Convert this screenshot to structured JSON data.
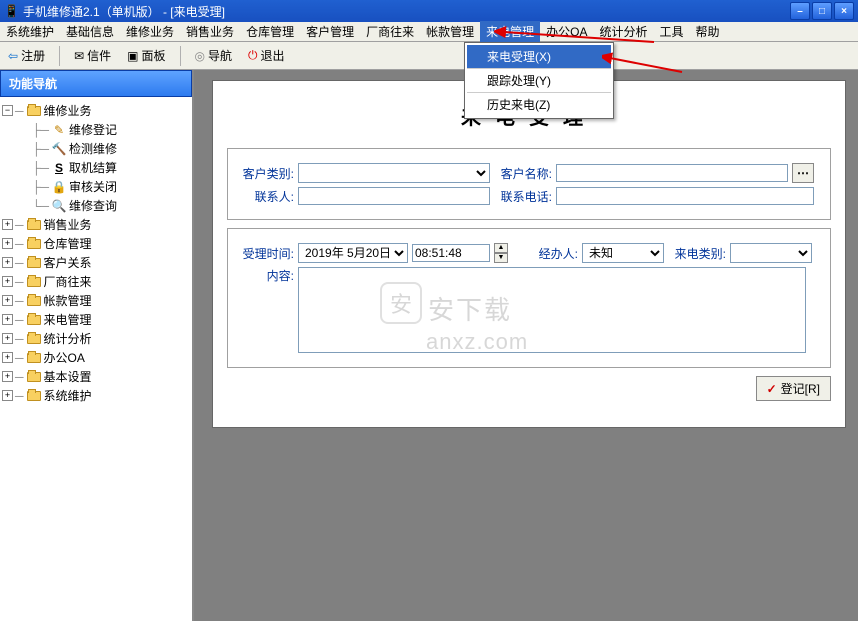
{
  "title": "手机维修通2.1（单机版） - [来电受理]",
  "window_controls": {
    "min": "–",
    "max": "□",
    "close": "×"
  },
  "menubar": [
    "系统维护",
    "基础信息",
    "维修业务",
    "销售业务",
    "仓库管理",
    "客户管理",
    "厂商往来",
    "帐款管理",
    "来电管理",
    "办公OA",
    "统计分析",
    "工具",
    "帮助"
  ],
  "toolbar": {
    "register": "注册",
    "letter": "信件",
    "panel": "面板",
    "nav": "导航",
    "exit": "退出"
  },
  "sidebar_header": "功能导航",
  "tree": {
    "root": "维修业务",
    "children": [
      {
        "icon": "pencil",
        "label": "维修登记"
      },
      {
        "icon": "hammer",
        "label": "检测维修"
      },
      {
        "icon": "s",
        "label": "取机结算"
      },
      {
        "icon": "lock",
        "label": "审核关闭"
      },
      {
        "icon": "search",
        "label": "维修查询"
      }
    ],
    "siblings": [
      "销售业务",
      "仓库管理",
      "客户关系",
      "厂商往来",
      "帐款管理",
      "来电管理",
      "统计分析",
      "办公OA",
      "基本设置",
      "系统维护"
    ]
  },
  "dropdown": {
    "items": [
      "来电受理(X)",
      "跟踪处理(Y)",
      "历史来电(Z)"
    ],
    "selected": 0
  },
  "form": {
    "title": "来电受理",
    "labels": {
      "cust_type": "客户类别:",
      "cust_name": "客户名称:",
      "contact": "联系人:",
      "phone": "联系电话:",
      "accept_time": "受理时间:",
      "handler": "经办人:",
      "call_type": "来电类别:",
      "content": "内容:"
    },
    "values": {
      "date": "2019年 5月20日",
      "time": "08:51:48",
      "handler": "未知"
    },
    "button": "登记[R]"
  },
  "watermark": {
    "brand": "安下载",
    "url": "anxz.com",
    "icon": "安"
  }
}
